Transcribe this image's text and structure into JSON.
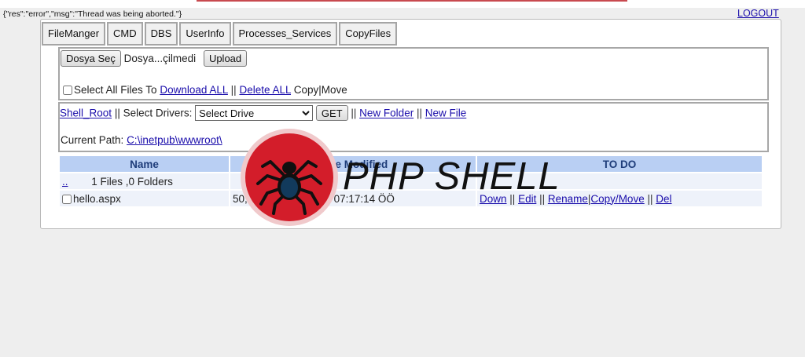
{
  "error_message": "{\"res\":\"error\",\"msg\":\"Thread was being aborted.\"}",
  "logout_label": "LOGOUT",
  "tabs": [
    "FileManger",
    "CMD",
    "DBS",
    "UserInfo",
    "Processes_Services",
    "CopyFiles"
  ],
  "upload": {
    "choose_file_label": "Dosya Seç",
    "file_status": "Dosya...çilmedi",
    "upload_label": "Upload",
    "select_all_text": "Select All Files To",
    "download_all_label": "Download ALL",
    "delete_all_label": "Delete ALL",
    "copy_move_text": "Copy|Move"
  },
  "nav": {
    "shell_root_label": "Shell_Root",
    "select_drivers_text": "|| Select Drivers:",
    "drive_selected": "Select Drive",
    "get_label": "GET",
    "new_folder_label": "New Folder",
    "new_file_label": "New File",
    "current_path_text": "Current Path:",
    "current_path_value": "C:\\inetpub\\wwwroot\\"
  },
  "table": {
    "headers": [
      "Name",
      "Date Modified",
      "TO DO"
    ],
    "parent_link": "..",
    "summary": "1 Files ,0 Folders",
    "file": {
      "name": "hello.aspx",
      "date_start": "50,",
      "date_end": "2022 - 07:17:14 ÖÖ",
      "actions": [
        "Down",
        "Edit",
        "Rename",
        "Copy/Move",
        "Del"
      ]
    }
  },
  "watermark": {
    "text": "PHP SHELL",
    "icon": "spider-icon",
    "colors": {
      "ring": "#f0c9cb",
      "disc": "#d31d2a",
      "spider": "#101010",
      "spider_body": "#123a5c"
    }
  }
}
